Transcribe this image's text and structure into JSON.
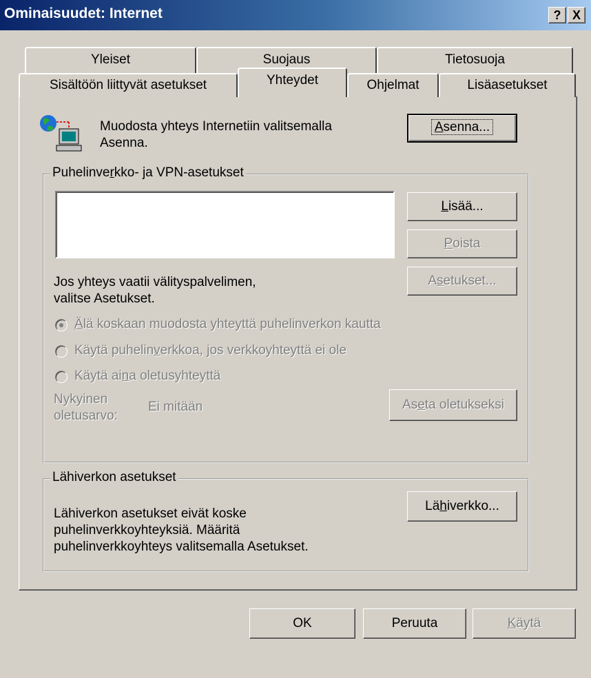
{
  "window": {
    "title": "Ominaisuudet: Internet",
    "help_button": "?",
    "close_button": "X"
  },
  "tabs_back": [
    {
      "label": "Yleiset"
    },
    {
      "label": "Suojaus"
    },
    {
      "label": "Tietosuoja"
    }
  ],
  "tabs_front": [
    {
      "label": "Sisältöön liittyvät asetukset"
    },
    {
      "label": "Yhteydet",
      "selected": true
    },
    {
      "label": "Ohjelmat"
    },
    {
      "label": "Lisäasetukset"
    }
  ],
  "setup": {
    "text_line1": "Muodosta yhteys Internetiin valitsemalla",
    "text_line2": "Asenna.",
    "button_rest": "senna...",
    "button_mnemonic": "A"
  },
  "dialup": {
    "legend_pre": "Puhelinve",
    "legend_mn": "r",
    "legend_post": "kko- ja VPN-asetukset",
    "add_pre": "",
    "add_mn": "L",
    "add_post": "isää...",
    "remove_pre": "",
    "remove_mn": "P",
    "remove_post": "oista",
    "settings_pre": "A",
    "settings_mn": "s",
    "settings_post": "etukset...",
    "proxy_line1": "Jos yhteys vaatii välityspalvelimen,",
    "proxy_line2": "valitse Asetukset.",
    "radio1_pre": "",
    "radio1_mn": "Ä",
    "radio1_post": "lä koskaan muodosta yhteyttä puhelinverkon kautta",
    "radio2_pre": "Käytä puhelin",
    "radio2_mn": "v",
    "radio2_post": "erkkoa, jos verkkoyhteyttä ei ole",
    "radio3_pre": "Käytä ai",
    "radio3_mn": "n",
    "radio3_post": "a oletusyhteyttä",
    "current_label_line1": "Nykyinen",
    "current_label_line2": "oletusarvo:",
    "current_value": "Ei mitään",
    "set_default_pre": "As",
    "set_default_mn": "e",
    "set_default_post": "ta oletukseksi"
  },
  "lan": {
    "legend": "Lähiverkon asetukset",
    "text_line1": "Lähiverkon asetukset eivät koske",
    "text_line2": "puhelinverkkoyhteyksiä. Määritä",
    "text_line3": "puhelinverkkoyhteys valitsemalla Asetukset.",
    "button_pre": "Lä",
    "button_mn": "h",
    "button_post": "iverkko..."
  },
  "footer": {
    "ok": "OK",
    "cancel": "Peruuta",
    "apply_pre": "",
    "apply_mn": "K",
    "apply_post": "äytä"
  }
}
